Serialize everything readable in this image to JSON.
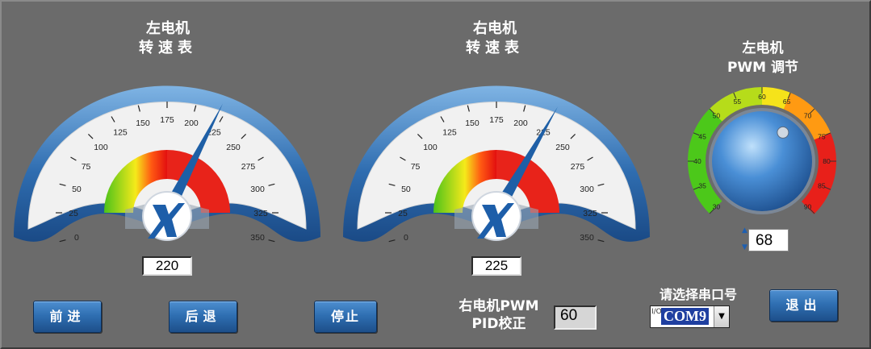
{
  "left_gauge": {
    "title_line1": "左电机",
    "title_line2": "转速表",
    "value": 220,
    "readout": "220",
    "ticks": [
      "0",
      "25",
      "50",
      "75",
      "100",
      "125",
      "150",
      "175",
      "200",
      "225",
      "250",
      "275",
      "300",
      "325",
      "350"
    ]
  },
  "right_gauge": {
    "title_line1": "右电机",
    "title_line2": "转速表",
    "value": 225,
    "readout": "225",
    "ticks": [
      "0",
      "25",
      "50",
      "75",
      "100",
      "125",
      "150",
      "175",
      "200",
      "225",
      "250",
      "275",
      "300",
      "325",
      "350"
    ]
  },
  "pwm_knob": {
    "title_line1": "左电机",
    "title_line2": "PWM 调节",
    "value": 68,
    "readout": "68",
    "ticks": [
      "30",
      "35",
      "40",
      "45",
      "50",
      "55",
      "60",
      "65",
      "70",
      "75",
      "80",
      "85",
      "90"
    ]
  },
  "buttons": {
    "forward": "前进",
    "backward": "后退",
    "stop": "停止",
    "exit": "退出"
  },
  "pid": {
    "label_line1": "右电机PWM",
    "label_line2": "PID校正",
    "value": "60"
  },
  "serial": {
    "label": "请选择串口号",
    "selected": "COM9",
    "io_prefix": "I/O"
  },
  "colors": {
    "background": "#6b6b6b",
    "gauge_blue": "#2f6db0",
    "button_blue": "#2f6fb2"
  }
}
